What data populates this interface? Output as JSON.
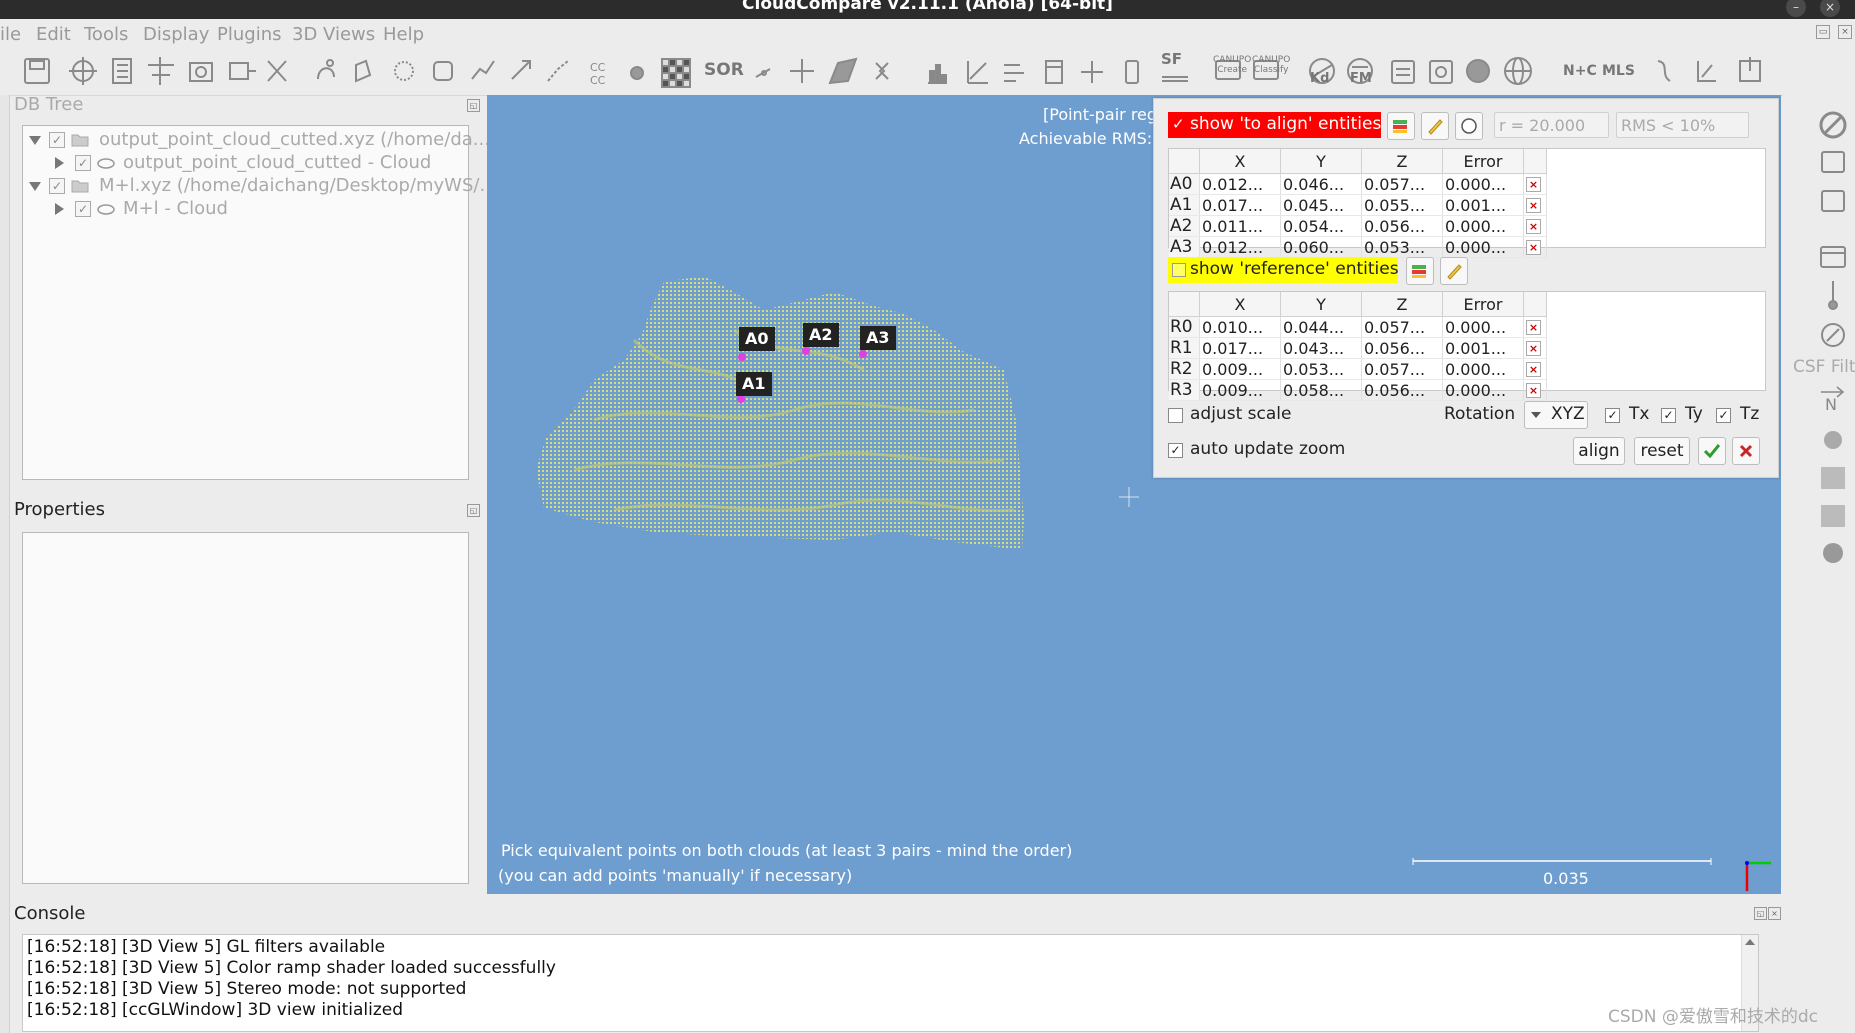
{
  "window": {
    "title": "CloudCompare v2.11.1 (Anoia) [64-bit]"
  },
  "menu": [
    "ile",
    "Edit",
    "Tools",
    "Display",
    "Plugins",
    "3D Views",
    "Help"
  ],
  "toolbar": {
    "sor_label": "SOR",
    "sf_label": "SF",
    "canupo_create": [
      "CANUPO",
      "Create"
    ],
    "canupo_classify": [
      "CANUPO",
      "Classify"
    ],
    "kd_label": "Kd",
    "fm_label": "FM",
    "nc_label": "N+C",
    "mls_label": "MLS"
  },
  "db_tree": {
    "title": "DB Tree",
    "items": [
      {
        "label": "output_point_cloud_cutted.xyz (/home/da..."
      },
      {
        "label": "output_point_cloud_cutted - Cloud"
      },
      {
        "label": "M+l.xyz (/home/daichang/Desktop/myWS/..."
      },
      {
        "label": "M+l - Cloud"
      }
    ]
  },
  "properties": {
    "title": "Properties"
  },
  "viewport": {
    "header_line1": "[Point-pair reg",
    "header_line2": "Achievable RMS: (",
    "labels": [
      "A0",
      "A1",
      "A2",
      "A3"
    ],
    "hint_line1": "Pick equivalent points on both clouds (at least 3 pairs - mind the order)",
    "hint_line2": "(you can add points 'manually' if necessary)",
    "scale_value": "0.035"
  },
  "registration": {
    "show_align_label": "show 'to align' entities",
    "show_align_checked": true,
    "show_reference_label": "show 'reference' entities",
    "show_reference_checked": false,
    "radius_field": "r = 20.000",
    "rms_field": "RMS < 10%",
    "columns": [
      "X",
      "Y",
      "Z",
      "Error"
    ],
    "align_rows": [
      {
        "id": "A0",
        "x": "0.012...",
        "y": "0.046...",
        "z": "0.057...",
        "err": "0.000..."
      },
      {
        "id": "A1",
        "x": "0.017...",
        "y": "0.045...",
        "z": "0.055...",
        "err": "0.001..."
      },
      {
        "id": "A2",
        "x": "0.011...",
        "y": "0.054...",
        "z": "0.056...",
        "err": "0.000..."
      },
      {
        "id": "A3",
        "x": "0.012...",
        "y": "0.060...",
        "z": "0.053...",
        "err": "0.000..."
      }
    ],
    "ref_rows": [
      {
        "id": "R0",
        "x": "0.010...",
        "y": "0.044...",
        "z": "0.057...",
        "err": "0.000..."
      },
      {
        "id": "R1",
        "x": "0.017...",
        "y": "0.043...",
        "z": "0.056...",
        "err": "0.001..."
      },
      {
        "id": "R2",
        "x": "0.009...",
        "y": "0.053...",
        "z": "0.057...",
        "err": "0.000..."
      },
      {
        "id": "R3",
        "x": "0.009...",
        "y": "0.058...",
        "z": "0.056...",
        "err": "0.000..."
      }
    ],
    "adjust_scale_label": "adjust scale",
    "adjust_scale_checked": false,
    "rotation_label": "Rotation",
    "rotation_value": "XYZ",
    "tx_label": "Tx",
    "ty_label": "Ty",
    "tz_label": "Tz",
    "auto_update_zoom_label": "auto update zoom",
    "auto_update_zoom_checked": true,
    "align_button": "align",
    "reset_button": "reset"
  },
  "right_toolbar": {
    "csf_label": "CSF Filt"
  },
  "console": {
    "title": "Console",
    "lines": [
      "[16:52:18] [3D View 5] GL filters available",
      "[16:52:18] [3D View 5] Color ramp shader loaded successfully",
      "[16:52:18] [3D View 5] Stereo mode: not supported",
      "[16:52:18] [ccGLWindow] 3D view initialized"
    ]
  },
  "watermark": "CSDN @爱傲雪和技术的dc",
  "colors": {
    "viewport_bg": "#6e9ed0",
    "align_highlight": "#ff0000",
    "reference_highlight": "#ffff00",
    "cloud_color": "#e8e86a",
    "point_marker": "#e040e0"
  }
}
